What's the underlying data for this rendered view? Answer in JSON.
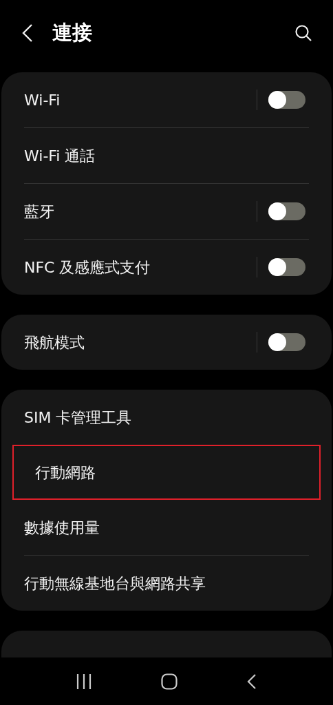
{
  "header": {
    "title": "連接"
  },
  "groups": [
    {
      "items": [
        {
          "label": "Wi-Fi",
          "kind": "toggle",
          "on": false,
          "highlighted": false
        },
        {
          "label": "Wi-Fi 通話",
          "kind": "link",
          "highlighted": false
        },
        {
          "label": "藍牙",
          "kind": "toggle",
          "on": false,
          "highlighted": false
        },
        {
          "label": "NFC 及感應式支付",
          "kind": "toggle",
          "on": false,
          "highlighted": false
        }
      ]
    },
    {
      "items": [
        {
          "label": "飛航模式",
          "kind": "toggle",
          "on": false,
          "highlighted": false
        }
      ]
    },
    {
      "items": [
        {
          "label": "SIM 卡管理工具",
          "kind": "link",
          "highlighted": false
        },
        {
          "label": "行動網路",
          "kind": "link",
          "highlighted": true
        },
        {
          "label": "數據使用量",
          "kind": "link",
          "highlighted": false
        },
        {
          "label": "行動無線基地台與網路共享",
          "kind": "link",
          "highlighted": false
        }
      ]
    }
  ]
}
